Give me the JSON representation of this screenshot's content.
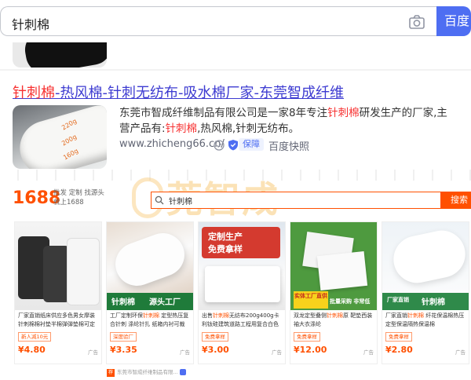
{
  "search": {
    "value": "针刺棉",
    "button_label": "百度"
  },
  "result": {
    "title_hl": "针刺棉",
    "title_rest": "-热风棉-针刺无纺布-吸水棉厂家-东莞智成纤维",
    "desc_a": "东莞市智成纤维制品有限公司是一家8年专注",
    "desc_hl1": "针刺棉",
    "desc_b": "研发生产的厂家,主营产品有:",
    "desc_hl2": "针刺棉",
    "desc_c": ",热风棉,针刺无纺布。",
    "url": "www.zhicheng66.cn/",
    "badge": "保障",
    "snapshot": "百度快照",
    "thumb_marks": [
      "220g",
      "200g",
      "160g"
    ]
  },
  "shot": {
    "logo": "1688",
    "logo_sub_1": "批发 定制 找源头",
    "logo_sub_2": "就上1688",
    "watermark": "莞智成",
    "search_text": "针刺棉",
    "search_btn": "搜索",
    "products": [
      {
        "title_a": "厂家直销纸床供应多色男女摩装针刺棉棉衬垫半棉弹弹垫棉可定制",
        "title_hl": "",
        "title_b": "",
        "tag": "新人减10元",
        "price": "¥4.80",
        "ad": "广告"
      },
      {
        "title_a": "工厂定制环保",
        "title_hl": "针刺棉",
        "title_b": " 定型热压复合针刺 涤纶针扎 纸箱内衬可裁切",
        "tag": "深度验厂",
        "price": "¥3.35",
        "ad": "广告",
        "img_text_1": "针刺棉",
        "img_text_2": "源头工厂"
      },
      {
        "title_a": "出售",
        "title_hl": "针刺棉",
        "title_b": "无纺布200g400g卡利钛硅建筑道路工程用复合白色无纺布",
        "tag": "免费拿样",
        "price": "¥3.00",
        "ad": "广告",
        "img_text_1": "定制生产",
        "img_text_2": "免费拿样"
      },
      {
        "title_a": "双龙定型叠侧",
        "title_hl": "针刺棉",
        "title_b": "原 靶垫西装袖大衣涤纶",
        "tag": "免费拿样",
        "price": "¥12.00",
        "ad": "广告",
        "img_text_1": "实体工厂直供",
        "img_text_2": "批量采购 非常低"
      },
      {
        "title_a": "厂家直销",
        "title_hl": "针刺棉",
        "title_b": " 纤花保温棉热压定型保温隔热保温棉",
        "tag": "免费拿样",
        "price": "¥2.80",
        "ad": "广告",
        "img_text_1": "针刺棉",
        "img_text_2": "厂家直销"
      }
    ],
    "next_item": "东莞市智成纤维制品有限..."
  }
}
